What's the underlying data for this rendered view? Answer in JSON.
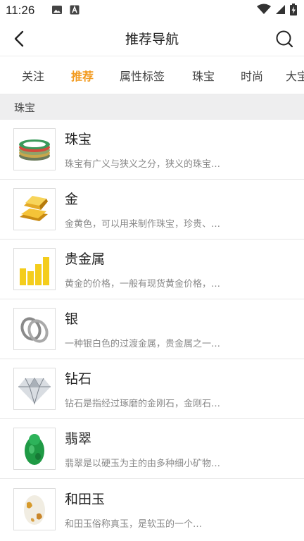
{
  "status_bar": {
    "time": "11:26",
    "icons": [
      "image-icon",
      "a-icon",
      "wifi-icon",
      "signal-icon",
      "battery-icon"
    ]
  },
  "header": {
    "title": "推荐导航",
    "back_icon": "back-arrow-icon",
    "search_icon": "search-icon"
  },
  "tabs": [
    {
      "label": "关注",
      "active": false
    },
    {
      "label": "推荐",
      "active": true
    },
    {
      "label": "属性标签",
      "active": false
    },
    {
      "label": "珠宝",
      "active": false
    },
    {
      "label": "时尚",
      "active": false
    },
    {
      "label": "大宝",
      "active": false
    }
  ],
  "section": {
    "title": "珠宝"
  },
  "items": [
    {
      "title": "珠宝",
      "desc": "珠宝有广义与狭义之分，狭义的珠宝…",
      "icon": "jewelry-icon"
    },
    {
      "title": "金",
      "desc": "金黄色，可以用来制作珠宝，珍贵、…",
      "icon": "gold-bar-icon"
    },
    {
      "title": "贵金属",
      "desc": "黄金的价格，一般有现货黄金价格，…",
      "icon": "bar-chart-icon"
    },
    {
      "title": "银",
      "desc": "一种银白色的过渡金属，贵金属之一…",
      "icon": "silver-rings-icon"
    },
    {
      "title": "钻石",
      "desc": "钻石是指经过琢磨的金刚石，金刚石…",
      "icon": "diamond-icon"
    },
    {
      "title": "翡翠",
      "desc": "翡翠是以硬玉为主的由多种细小矿物…",
      "icon": "jade-icon"
    },
    {
      "title": "和田玉",
      "desc": "和田玉俗称真玉，是软玉的一个…",
      "icon": "hetian-jade-icon"
    }
  ],
  "colors": {
    "accent": "#f29a1f",
    "section_bg": "#eeeeef",
    "divider": "#e6e6e6"
  }
}
